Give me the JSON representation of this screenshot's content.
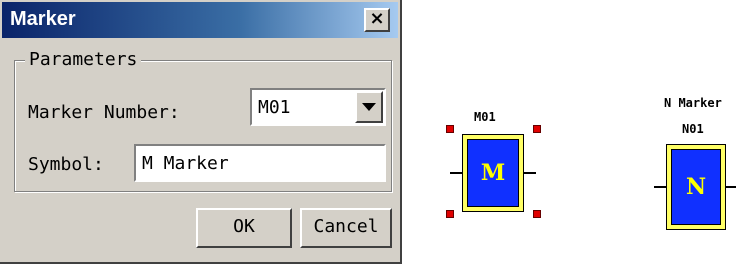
{
  "dialog": {
    "title": "Marker",
    "close_glyph": "×",
    "group_label": "Parameters",
    "marker_number_label": "Marker Number:",
    "marker_number_value": "M01",
    "symbol_label": "Symbol:",
    "symbol_value": "M Marker",
    "ok_label": "OK",
    "cancel_label": "Cancel"
  },
  "blocks": [
    {
      "name_label": "M01",
      "letter": "M",
      "selected": true
    },
    {
      "symbol_label": "N Marker",
      "name_label": "N01",
      "letter": "N",
      "selected": false
    }
  ],
  "colors": {
    "block_fill": "#1030ff",
    "block_border": "#ffff66",
    "block_letter": "#ffff00",
    "selection_handle": "#e00000",
    "titlebar": "#0a246a"
  }
}
